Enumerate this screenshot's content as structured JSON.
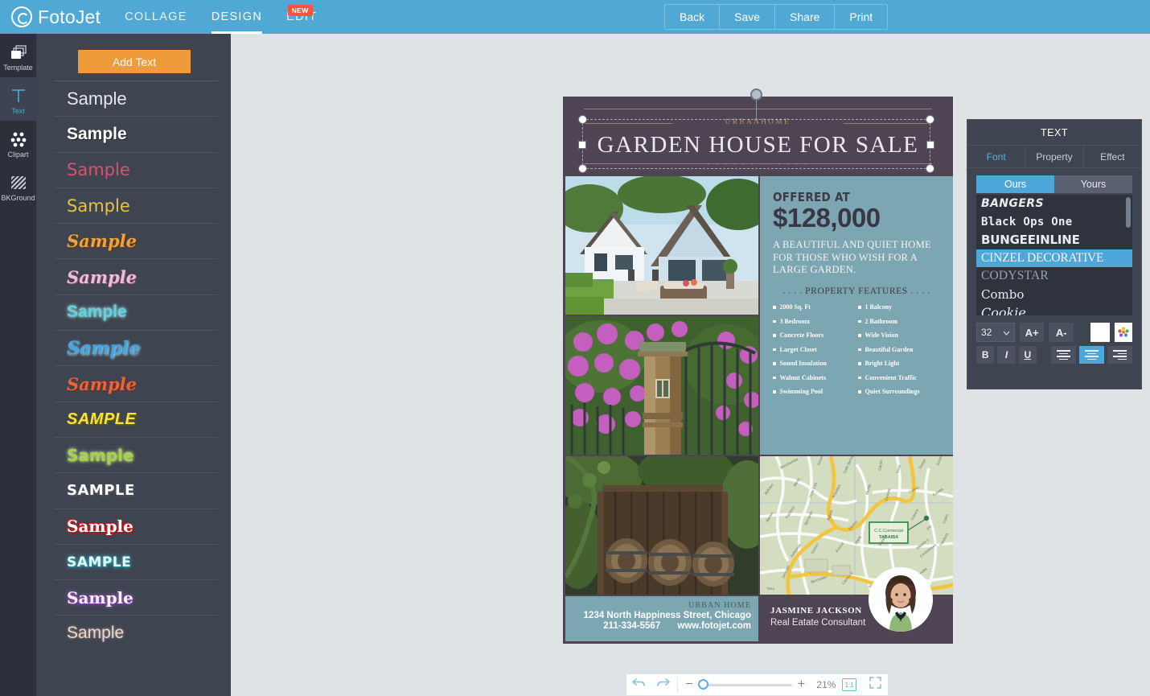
{
  "app": {
    "brand": "FotoJet",
    "nav": [
      {
        "label": "COLLAGE",
        "active": false,
        "badge": ""
      },
      {
        "label": "DESIGN",
        "active": true,
        "badge": ""
      },
      {
        "label": "EDIT",
        "active": false,
        "badge": "NEW"
      }
    ],
    "actions": [
      "Back",
      "Save",
      "Share",
      "Print"
    ],
    "accent": "#4fa9d4",
    "panel_bg": "#3e4450",
    "canvas_bg": "#e0e3e6"
  },
  "rail": {
    "items": [
      {
        "label": "Template",
        "icon": "layers-icon",
        "active": false
      },
      {
        "label": "Text",
        "icon": "text-t-icon",
        "active": true
      },
      {
        "label": "Clipart",
        "icon": "clipart-dots-icon",
        "active": false
      },
      {
        "label": "BKGround",
        "icon": "hatch-pattern-icon",
        "active": false
      }
    ]
  },
  "style_panel": {
    "add_text_label": "Add Text",
    "add_text_color": "#ef9a3b",
    "samples": [
      {
        "text": "Sample",
        "style": "s1"
      },
      {
        "text": "Sample",
        "style": "s2"
      },
      {
        "text": "Sample",
        "style": "s3"
      },
      {
        "text": "Sample",
        "style": "s4"
      },
      {
        "text": "Sample",
        "style": "s5"
      },
      {
        "text": "Sample",
        "style": "s6"
      },
      {
        "text": "Sample",
        "style": "s7"
      },
      {
        "text": "Sample",
        "style": "s8"
      },
      {
        "text": "Sample",
        "style": "s9"
      },
      {
        "text": "SAMPLE",
        "style": "s10"
      },
      {
        "text": "Sample",
        "style": "s11"
      },
      {
        "text": "SAMPLE",
        "style": "s12"
      },
      {
        "text": "Sample",
        "style": "s13"
      },
      {
        "text": "SAMPLE",
        "style": "s14"
      },
      {
        "text": "Sample",
        "style": "s15"
      },
      {
        "text": "Sample",
        "style": "s16"
      }
    ]
  },
  "poster": {
    "brand": "URBANHOME",
    "title": "GARDEN HOUSE FOR SALE",
    "dots": ". . . .    . . . .    . . . .",
    "offered_label": "OFFERED AT",
    "price": "$128,000",
    "description": "A BEAUTIFUL AND QUIET HOME FOR THOSE WHO WISH FOR A LARGE GARDEN.",
    "features_heading": ". . . . PROPERTY FEATURES . . . .",
    "features": [
      "2000 Sq. Ft",
      "1 Balcony",
      "3 Bedroom",
      "2 Bathroom",
      "Concrete Floors",
      "Wide Vision",
      "Larget Closet",
      "Beautiful Garden",
      "Sound Insulation",
      "Bright Light",
      "Walnut Cabinets",
      "Convenient Traffic",
      "Swimming Pool",
      "Quiet Surroundings"
    ],
    "footer_left": {
      "brand": "URBAN HOME",
      "address": "1234 North Happiness Street, Chicago",
      "phone": "211-334-5567",
      "website": "www.fotojet.com"
    },
    "footer_right": {
      "name": "JASMINE JACKSON",
      "role": "Real Eatate Consultant"
    },
    "colors": {
      "plum": "#4e4454",
      "teal": "#7ba6b2",
      "gold": "#9c7f63"
    }
  },
  "bottom_toolbar": {
    "undo": "undo-icon",
    "redo": "redo-icon",
    "zoom_out": "−",
    "zoom_in": "+",
    "zoom_level": "21%",
    "one_to_one": "1:1",
    "fullscreen": "fullscreen-icon"
  },
  "text_panel": {
    "title": "TEXT",
    "tabs": [
      {
        "label": "Font",
        "active": true
      },
      {
        "label": "Property",
        "active": false
      },
      {
        "label": "Effect",
        "active": false
      }
    ],
    "source_tabs": [
      {
        "label": "Ours",
        "active": true
      },
      {
        "label": "Yours",
        "active": false
      }
    ],
    "fonts": [
      {
        "name": "BANGERS",
        "class": "f-bangers",
        "selected": false
      },
      {
        "name": "Black Ops One",
        "class": "f-blackops",
        "selected": false
      },
      {
        "name": "BUNGEEINLINE",
        "class": "f-bungee",
        "selected": false
      },
      {
        "name": "CINZEL DECORATIVE",
        "class": "f-cinzel",
        "selected": true
      },
      {
        "name": "CODYSTAR",
        "class": "f-codystar",
        "selected": false
      },
      {
        "name": "Combo",
        "class": "f-combo",
        "selected": false
      },
      {
        "name": "Cookie",
        "class": "f-cookie",
        "selected": false
      }
    ],
    "font_size": "32",
    "increase_label": "A+",
    "decrease_label": "A-",
    "text_color": "#ffffff",
    "bold_label": "B",
    "italic_label": "I",
    "underline_label": "U",
    "align": "center",
    "highlight_color": "#4da7d8"
  }
}
